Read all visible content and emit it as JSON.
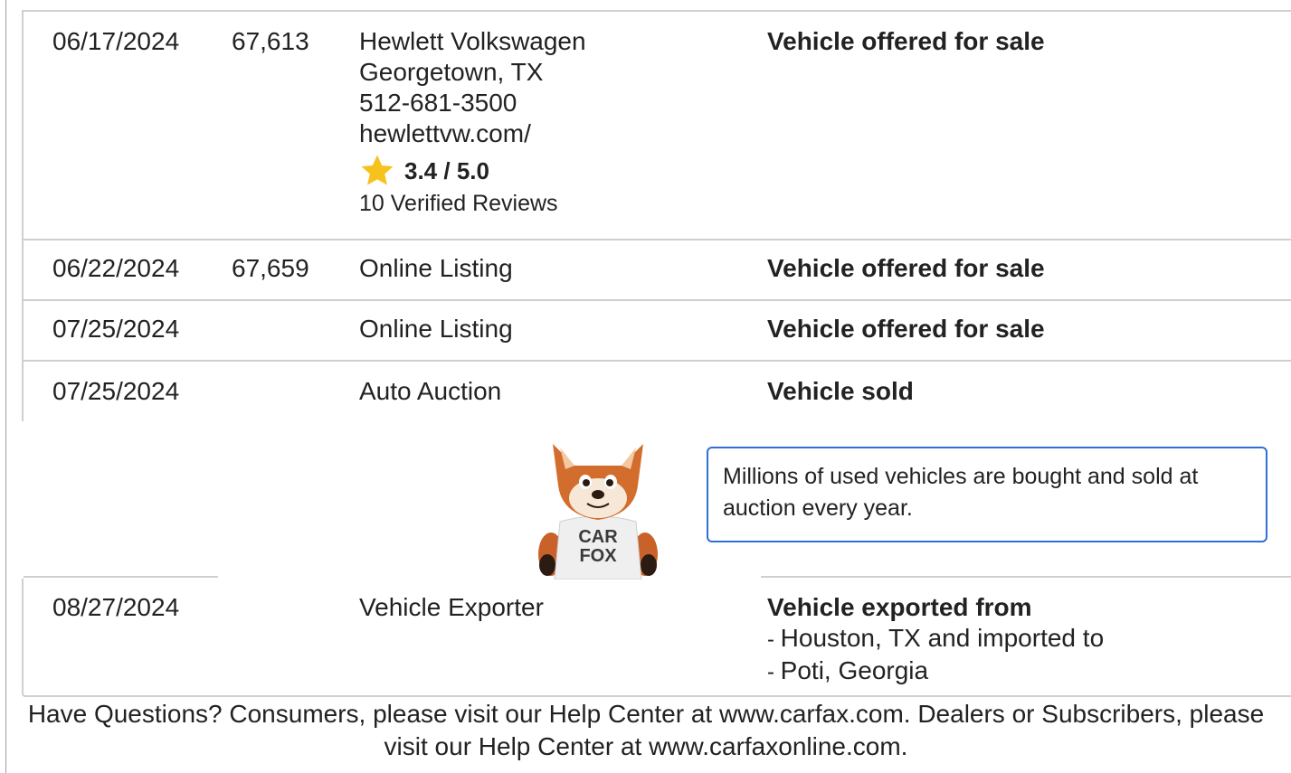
{
  "records": [
    {
      "date": "06/17/2024",
      "odometer": "67,613",
      "source": {
        "name": "Hewlett Volkswagen",
        "location": "Georgetown, TX",
        "phone": "512-681-3500",
        "website": "hewlettvw.com/",
        "rating": "3.4 / 5.0",
        "reviews": "10 Verified Reviews"
      },
      "comment": "Vehicle offered for sale"
    },
    {
      "date": "06/22/2024",
      "odometer": "67,659",
      "source": "Online Listing",
      "comment": "Vehicle offered for sale"
    },
    {
      "date": "07/25/2024",
      "odometer": "",
      "source": "Online Listing",
      "comment": "Vehicle offered for sale"
    },
    {
      "date": "07/25/2024",
      "odometer": "",
      "source": "Auto Auction",
      "comment": "Vehicle sold"
    },
    {
      "date": "08/27/2024",
      "odometer": "",
      "source": "Vehicle Exporter",
      "comment": "Vehicle exported from",
      "details": [
        "Houston, TX and imported to",
        "Poti, Georgia"
      ]
    }
  ],
  "callout": {
    "text": "Millions of used vehicles are bought and sold at auction every year.",
    "mascot_shirt_line1": "CAR",
    "mascot_shirt_line2": "FOX"
  },
  "footer": {
    "text": "Have Questions? Consumers, please visit our Help Center at www.carfax.com. Dealers or Subscribers, please visit our Help Center at www.carfaxonline.com."
  },
  "colors": {
    "border": "#cfcfcf",
    "callout_border": "#2f6fd6",
    "star": "#f7c21b"
  },
  "icons": {
    "rating": "star-icon",
    "mascot": "carfox-mascot-icon"
  }
}
